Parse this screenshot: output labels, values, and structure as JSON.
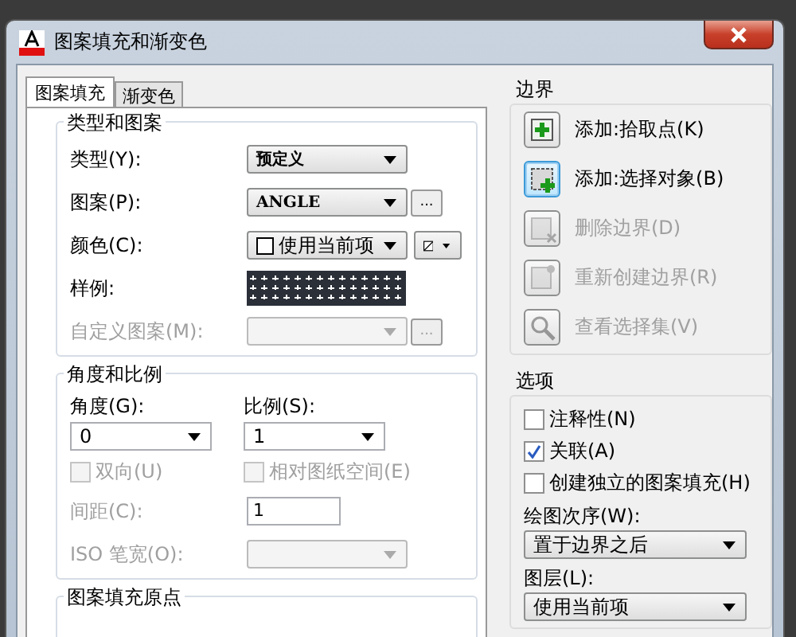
{
  "window": {
    "title": "图案填充和渐变色"
  },
  "tabs": [
    {
      "label": "图案填充",
      "selected": true
    },
    {
      "label": "渐变色",
      "selected": false
    }
  ],
  "type_pattern": {
    "title": "类型和图案",
    "rows": [
      {
        "kind": "combo",
        "label": "类型(Y):",
        "value": "预定义",
        "disabled": false
      },
      {
        "kind": "combo",
        "label": "图案(P):",
        "value": "ANGLE",
        "disabled": false,
        "more": "..."
      },
      {
        "kind": "color",
        "label": "颜色(C):",
        "value": "使用当前项",
        "disabled": false
      },
      {
        "kind": "swatch",
        "label": "样例:",
        "disabled": false
      },
      {
        "kind": "combo",
        "label": "自定义图案(M):",
        "disabled": true,
        "more": "..."
      }
    ]
  },
  "angle_scale": {
    "title": "角度和比例",
    "angle": {
      "label": "角度(G):",
      "value": "0"
    },
    "scale": {
      "label": "比例(S):",
      "value": "1"
    },
    "checkboxes": [
      {
        "label": "双向(U)",
        "checked": false,
        "disabled": true
      },
      {
        "label": "相对图纸空间(E)",
        "checked": false,
        "disabled": true
      }
    ],
    "spacing": {
      "label": "间距(C):",
      "value": "1",
      "disabled": true
    },
    "iso_pen": {
      "label": "ISO 笔宽(O):",
      "disabled": true
    }
  },
  "origin": {
    "title": "图案填充原点"
  },
  "boundaries": {
    "title": "边界",
    "buttons": [
      {
        "kind": "pick",
        "label": "添加:拾取点(K)",
        "disabled": false,
        "focused": false
      },
      {
        "kind": "select",
        "label": "添加:选择对象(B)",
        "disabled": false,
        "focused": true
      },
      {
        "kind": "remove",
        "label": "删除边界(D)",
        "disabled": true,
        "focused": false
      },
      {
        "kind": "recreate",
        "label": "重新创建边界(R)",
        "disabled": true,
        "focused": false
      },
      {
        "kind": "view",
        "label": "查看选择集(V)",
        "disabled": true,
        "focused": false
      }
    ]
  },
  "options": {
    "title": "选项",
    "checkboxes": [
      {
        "label": "注释性(N)",
        "checked": false,
        "disabled": false
      },
      {
        "label": "关联(A)",
        "checked": true,
        "disabled": false
      },
      {
        "label": "创建独立的图案填充(H)",
        "checked": false,
        "disabled": false
      }
    ],
    "draw_order": {
      "label": "绘图次序(W):",
      "value": "置于边界之后"
    },
    "layer": {
      "label": "图层(L):",
      "value": "使用当前项"
    }
  }
}
